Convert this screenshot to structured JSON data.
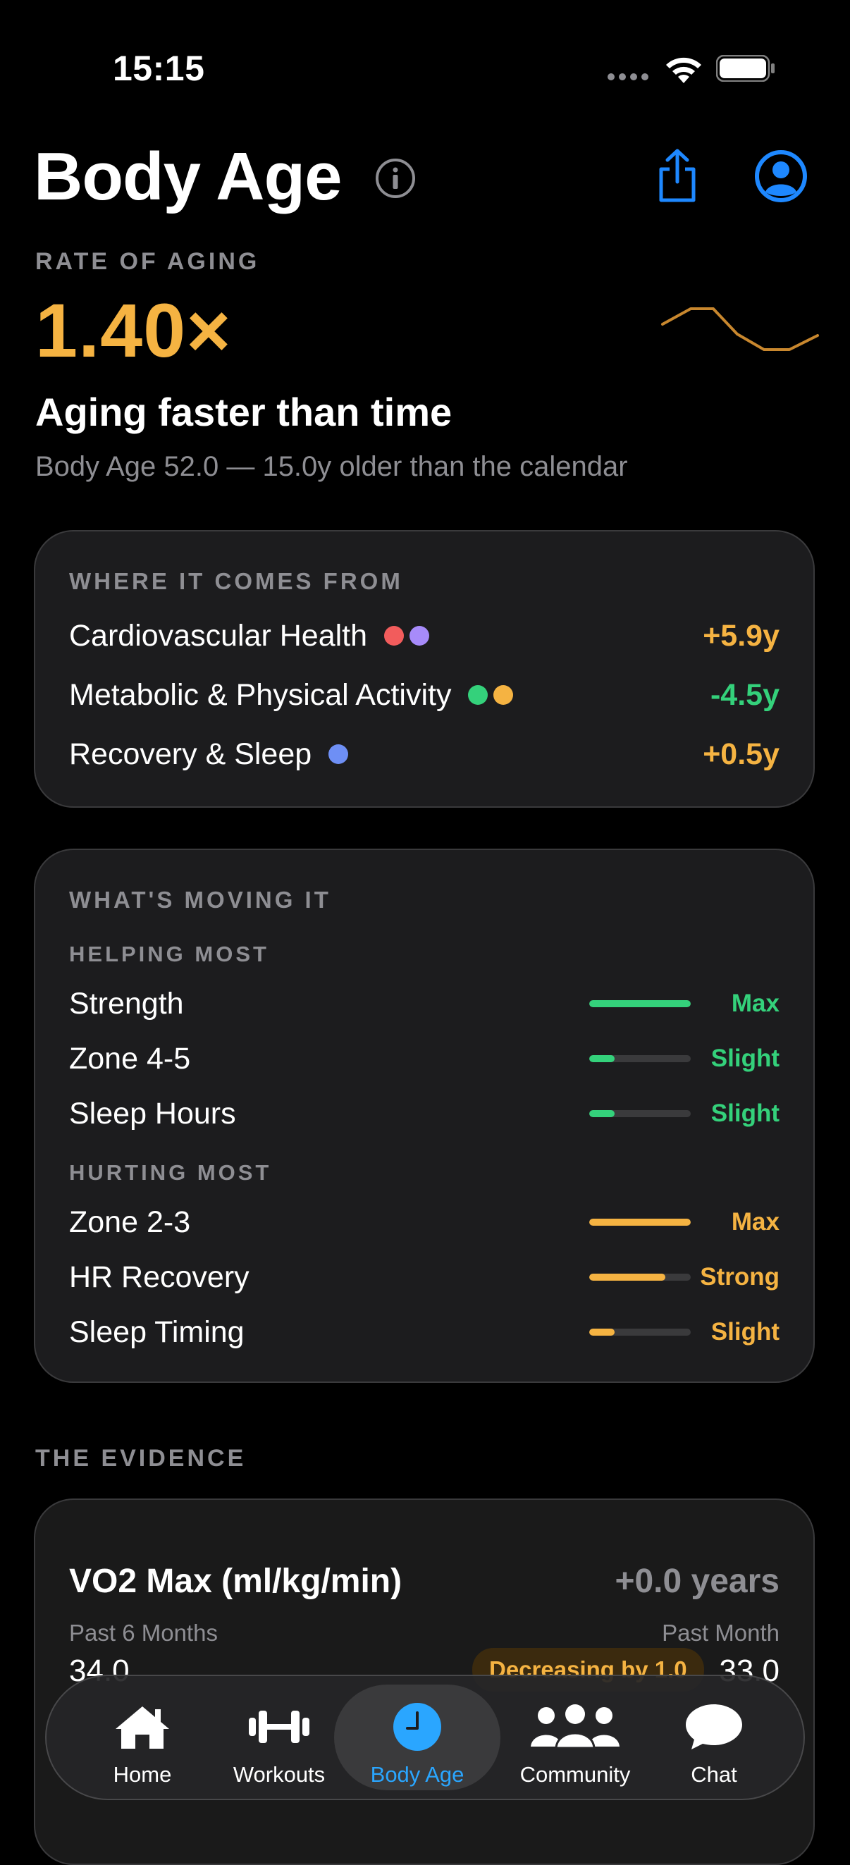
{
  "status_bar": {
    "time": "15:15"
  },
  "header": {
    "title": "Body Age"
  },
  "rate": {
    "label": "RATE OF AGING",
    "value": "1.40×",
    "headline": "Aging faster than time",
    "subline": "Body Age 52.0 — 15.0y older than the calendar"
  },
  "colors": {
    "orange": "#f5b342",
    "green": "#34d17b",
    "blue": "#2aa6ff",
    "red": "#f25c5c",
    "purple": "#a78bfa",
    "periwinkle": "#6e8ff5"
  },
  "sources": {
    "label": "WHERE IT COMES FROM",
    "items": [
      {
        "name": "Cardiovascular Health",
        "value": "+5.9y"
      },
      {
        "name": "Metabolic & Physical Activity",
        "value": "-4.5y"
      },
      {
        "name": "Recovery & Sleep",
        "value": "+0.5y"
      }
    ]
  },
  "moving": {
    "label": "WHAT'S MOVING IT",
    "helping_label": "HELPING MOST",
    "hurting_label": "HURTING MOST",
    "helping": [
      {
        "name": "Strength",
        "strength": "Max",
        "level": 1.0
      },
      {
        "name": "Zone 4-5",
        "strength": "Slight",
        "level": 0.25
      },
      {
        "name": "Sleep Hours",
        "strength": "Slight",
        "level": 0.25
      }
    ],
    "hurting": [
      {
        "name": "Zone 2-3",
        "strength": "Max",
        "level": 1.0
      },
      {
        "name": "HR Recovery",
        "strength": "Strong",
        "level": 0.75
      },
      {
        "name": "Sleep Timing",
        "strength": "Slight",
        "level": 0.25
      }
    ]
  },
  "evidence": {
    "label": "THE EVIDENCE",
    "title": "VO2 Max (ml/kg/min)",
    "delta": "+0.0 years",
    "past6_label": "Past 6 Months",
    "pastm_label": "Past Month",
    "past6_value": "34.0",
    "pastm_value": "33.0",
    "badge": "Decreasing by 1.0"
  },
  "tabs": [
    {
      "label": "Home",
      "icon": "house-icon"
    },
    {
      "label": "Workouts",
      "icon": "dumbbell-icon"
    },
    {
      "label": "Body Age",
      "icon": "clock-icon"
    },
    {
      "label": "Community",
      "icon": "people-icon"
    },
    {
      "label": "Chat",
      "icon": "speech-bubble-icon"
    }
  ]
}
